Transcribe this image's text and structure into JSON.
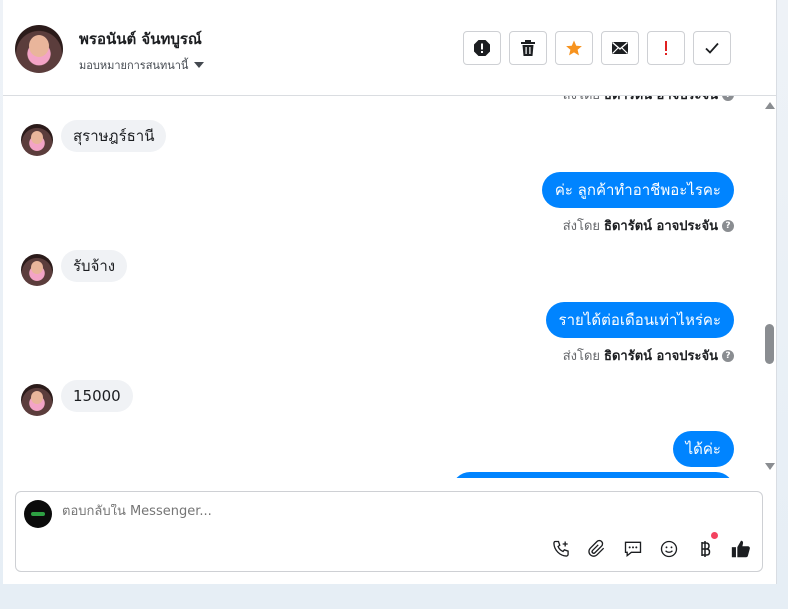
{
  "header": {
    "contact_name": "พรอนันต์ จันทบูรณ์",
    "assign_label": "มอบหมายการสนทนานี้"
  },
  "toolbar": [
    {
      "name": "spam-icon"
    },
    {
      "name": "trash-icon"
    },
    {
      "name": "star-icon",
      "color": "#f7931e"
    },
    {
      "name": "mail-icon"
    },
    {
      "name": "important-icon",
      "color": "#e02020"
    },
    {
      "name": "check-icon"
    }
  ],
  "messages": {
    "sent_prefix": "ส่งโดย",
    "agent_name": "ธิดารัตน์ อาจประจัน",
    "items": [
      {
        "dir": "in",
        "text": "สุราษฎร์ธานี"
      },
      {
        "dir": "out",
        "text": "ค่ะ ลูกค้าทำอาชีพอะไรคะ"
      },
      {
        "dir": "in",
        "text": "รับจ้าง"
      },
      {
        "dir": "out",
        "text": "รายได้ต่อเดือนเท่าไหร่คะ"
      },
      {
        "dir": "in",
        "text": "15000"
      },
      {
        "dir": "out",
        "text": "ได้ค่ะ"
      }
    ]
  },
  "composer": {
    "placeholder": "ตอบกลับใน Messenger..."
  },
  "colors": {
    "accent": "#0084ff",
    "incoming_bubble": "#f0f2f5"
  }
}
